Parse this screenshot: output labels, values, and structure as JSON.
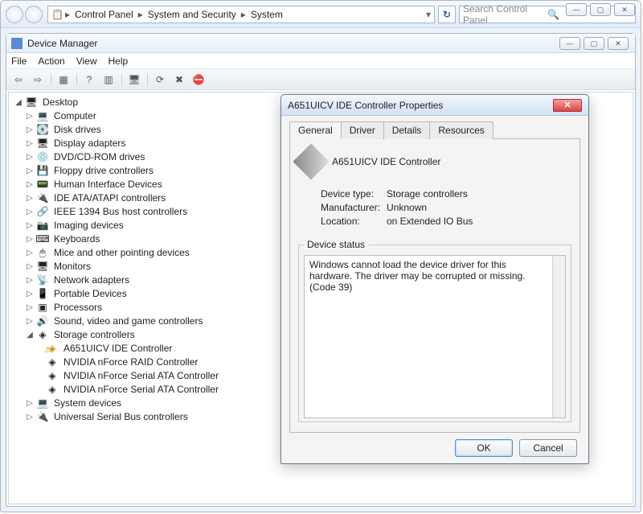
{
  "breadcrumb": {
    "items": [
      "Control Panel",
      "System and Security",
      "System"
    ]
  },
  "search": {
    "placeholder": "Search Control Panel"
  },
  "devmgr": {
    "title": "Device Manager",
    "menus": [
      "File",
      "Action",
      "View",
      "Help"
    ],
    "root": "Desktop",
    "storage": "Storage controllers",
    "storage_children": [
      "A651UICV IDE Controller",
      "NVIDIA nForce RAID Controller",
      "NVIDIA nForce Serial ATA Controller",
      "NVIDIA nForce Serial ATA Controller"
    ],
    "nodes": [
      "Computer",
      "Disk drives",
      "Display adapters",
      "DVD/CD-ROM drives",
      "Floppy drive controllers",
      "Human Interface Devices",
      "IDE ATA/ATAPI controllers",
      "IEEE 1394 Bus host controllers",
      "Imaging devices",
      "Keyboards",
      "Mice and other pointing devices",
      "Monitors",
      "Network adapters",
      "Portable Devices",
      "Processors",
      "Sound, video and game controllers"
    ],
    "tail": [
      "System devices",
      "Universal Serial Bus controllers"
    ]
  },
  "dialog": {
    "title": "A651UICV IDE Controller Properties",
    "tabs": [
      "General",
      "Driver",
      "Details",
      "Resources"
    ],
    "name": "A651UICV IDE Controller",
    "dtype_l": "Device type:",
    "dtype_v": "Storage controllers",
    "manuf_l": "Manufacturer:",
    "manuf_v": "Unknown",
    "loc_l": "Location:",
    "loc_v": "on Extended IO Bus",
    "status_legend": "Device status",
    "status_text": "Windows cannot load the device driver for this hardware. The driver may be corrupted or missing. (Code 39)",
    "ok": "OK",
    "cancel": "Cancel"
  }
}
